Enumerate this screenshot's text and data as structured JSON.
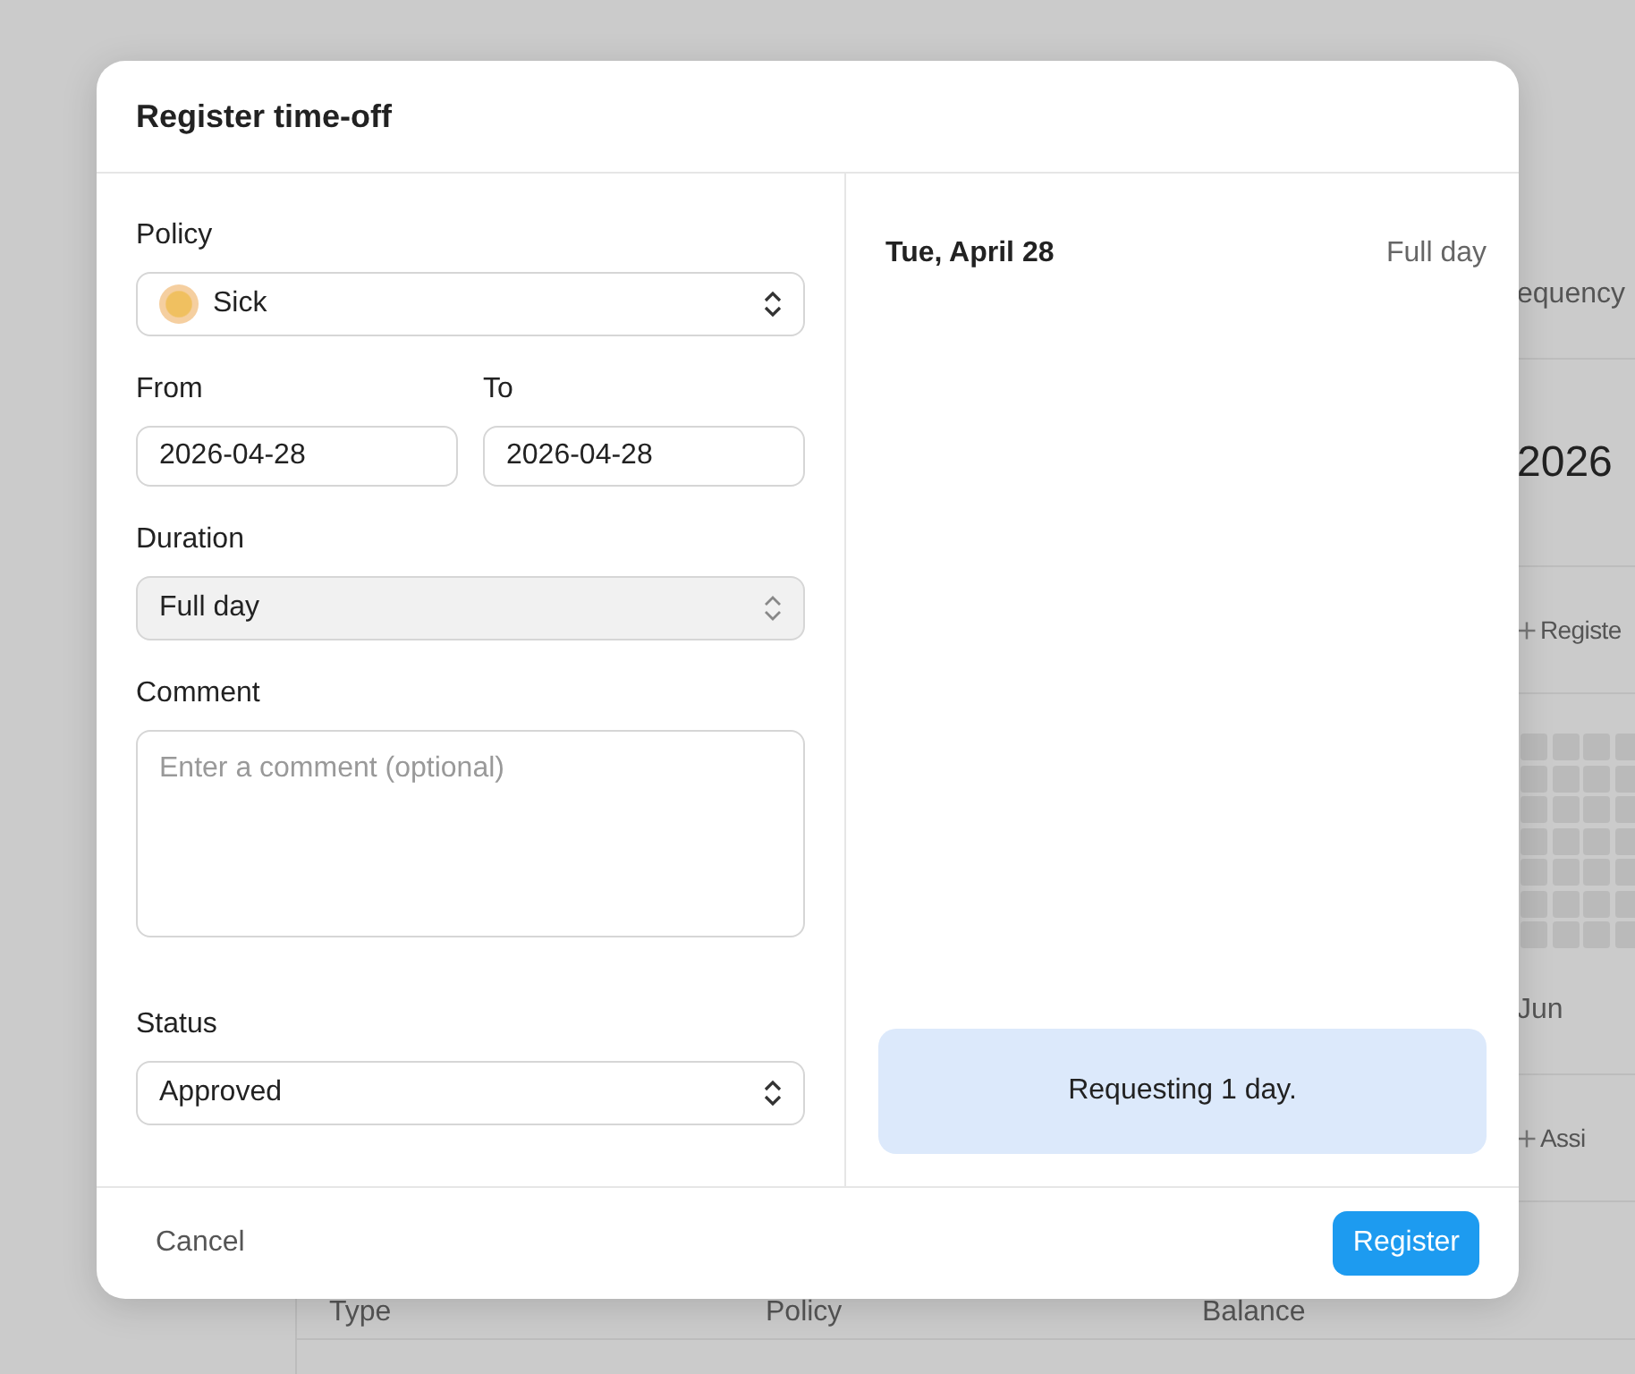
{
  "background": {
    "side": [
      {
        "kind": "text",
        "text": "equency"
      },
      {
        "kind": "year",
        "text": "2026"
      },
      {
        "kind": "action",
        "text": "Registe"
      },
      {
        "kind": "heatmap"
      },
      {
        "kind": "text",
        "text": "Jun"
      },
      {
        "kind": "action",
        "text": "Assi"
      }
    ],
    "table": {
      "columns": [
        "Type",
        "Policy",
        "Balance"
      ]
    }
  },
  "dialog": {
    "title": "Register time-off",
    "policy": {
      "label": "Policy",
      "value": "Sick"
    },
    "from": {
      "label": "From",
      "value": "2026-04-28"
    },
    "to": {
      "label": "To",
      "value": "2026-04-28"
    },
    "duration": {
      "label": "Duration",
      "value": "Full day",
      "disabled": true
    },
    "comment": {
      "label": "Comment",
      "placeholder": "Enter a comment (optional)"
    },
    "status": {
      "label": "Status",
      "value": "Approved"
    },
    "summary": {
      "date": "Tue, April 28",
      "duration": "Full day",
      "message": "Requesting 1 day."
    },
    "buttons": {
      "cancel": "Cancel",
      "register": "Register"
    }
  }
}
